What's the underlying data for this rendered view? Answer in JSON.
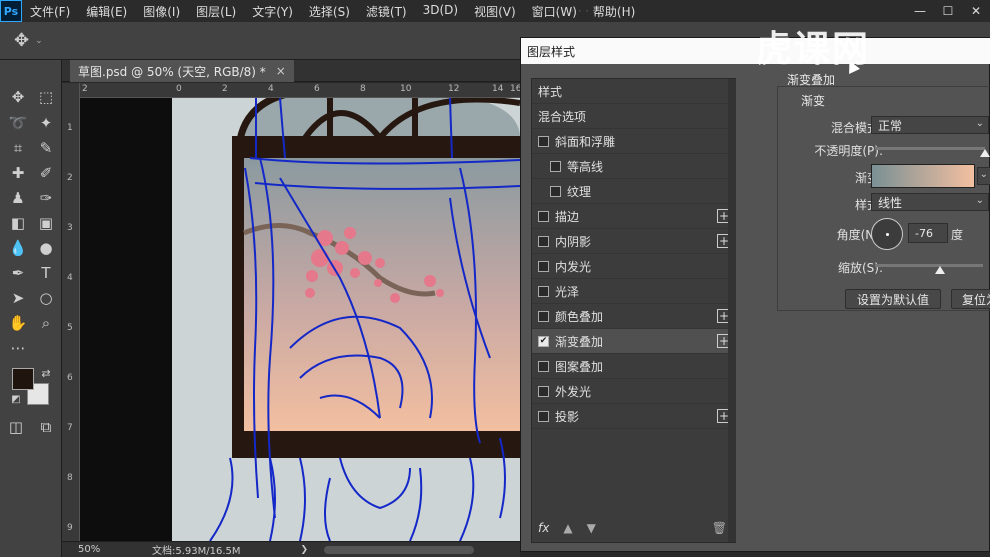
{
  "app": {
    "logo": "Ps",
    "menu": [
      "文件(F)",
      "编辑(E)",
      "图像(I)",
      "图层(L)",
      "文字(Y)",
      "选择(S)",
      "滤镜(T)",
      "3D(D)",
      "视图(V)",
      "窗口(W)",
      "帮助(H)"
    ],
    "window_controls": [
      "—",
      "☐",
      "✕"
    ]
  },
  "document": {
    "tab_title": "草图.psd @ 50% (天空, RGB/8) *",
    "close_glyph": "×",
    "ruler_top": [
      "2",
      "0",
      "2",
      "4",
      "6",
      "8",
      "10",
      "12",
      "14",
      "16"
    ],
    "ruler_left": [
      "1",
      "2",
      "3",
      "4",
      "5",
      "6",
      "7",
      "8",
      "9"
    ]
  },
  "status": {
    "zoom": "50%",
    "doc_info": "文档:5.93M/16.5M",
    "caret": "❯"
  },
  "dialog": {
    "title": "图层样式",
    "watermark": "虎课网",
    "left_panel": {
      "header": "样式",
      "blend_options": "混合选项",
      "items": [
        {
          "label": "斜面和浮雕",
          "checked": false,
          "plus": false,
          "indent": false
        },
        {
          "label": "等高线",
          "checked": false,
          "plus": false,
          "indent": true
        },
        {
          "label": "纹理",
          "checked": false,
          "plus": false,
          "indent": true
        },
        {
          "label": "描边",
          "checked": false,
          "plus": true,
          "indent": false
        },
        {
          "label": "内阴影",
          "checked": false,
          "plus": true,
          "indent": false
        },
        {
          "label": "内发光",
          "checked": false,
          "plus": false,
          "indent": false
        },
        {
          "label": "光泽",
          "checked": false,
          "plus": false,
          "indent": false
        },
        {
          "label": "颜色叠加",
          "checked": false,
          "plus": true,
          "indent": false
        },
        {
          "label": "渐变叠加",
          "checked": true,
          "plus": true,
          "indent": false,
          "selected": true
        },
        {
          "label": "图案叠加",
          "checked": false,
          "plus": false,
          "indent": false
        },
        {
          "label": "外发光",
          "checked": false,
          "plus": false,
          "indent": false
        },
        {
          "label": "投影",
          "checked": false,
          "plus": true,
          "indent": false
        }
      ],
      "footer_fx": "fx",
      "footer_up": "▲",
      "footer_down": "▼",
      "footer_trash": "🗑"
    },
    "right_panel": {
      "section_title": "渐变叠加",
      "group_title": "渐变",
      "blend_mode_label": "混合模式:",
      "blend_mode_value": "正常",
      "opacity_label": "不透明度(P):",
      "opacity_value": 100,
      "gradient_label": "渐变:",
      "gradient_colors": [
        "#7a9094",
        "#f3bfa0"
      ],
      "style_label": "样式:",
      "style_value": "线性",
      "angle_label": "角度(N):",
      "angle_value": "-76",
      "angle_unit": "度",
      "scale_label": "缩放(S):",
      "scale_value": 100,
      "btn_default": "设置为默认值",
      "btn_reset": "复位为"
    }
  },
  "colors": {
    "foreground": "#1f140e",
    "background": "#e6e6e6",
    "sketch_stroke": "#1428c8",
    "frame": "#261810",
    "canvas_bg": "#cdd4d6"
  }
}
